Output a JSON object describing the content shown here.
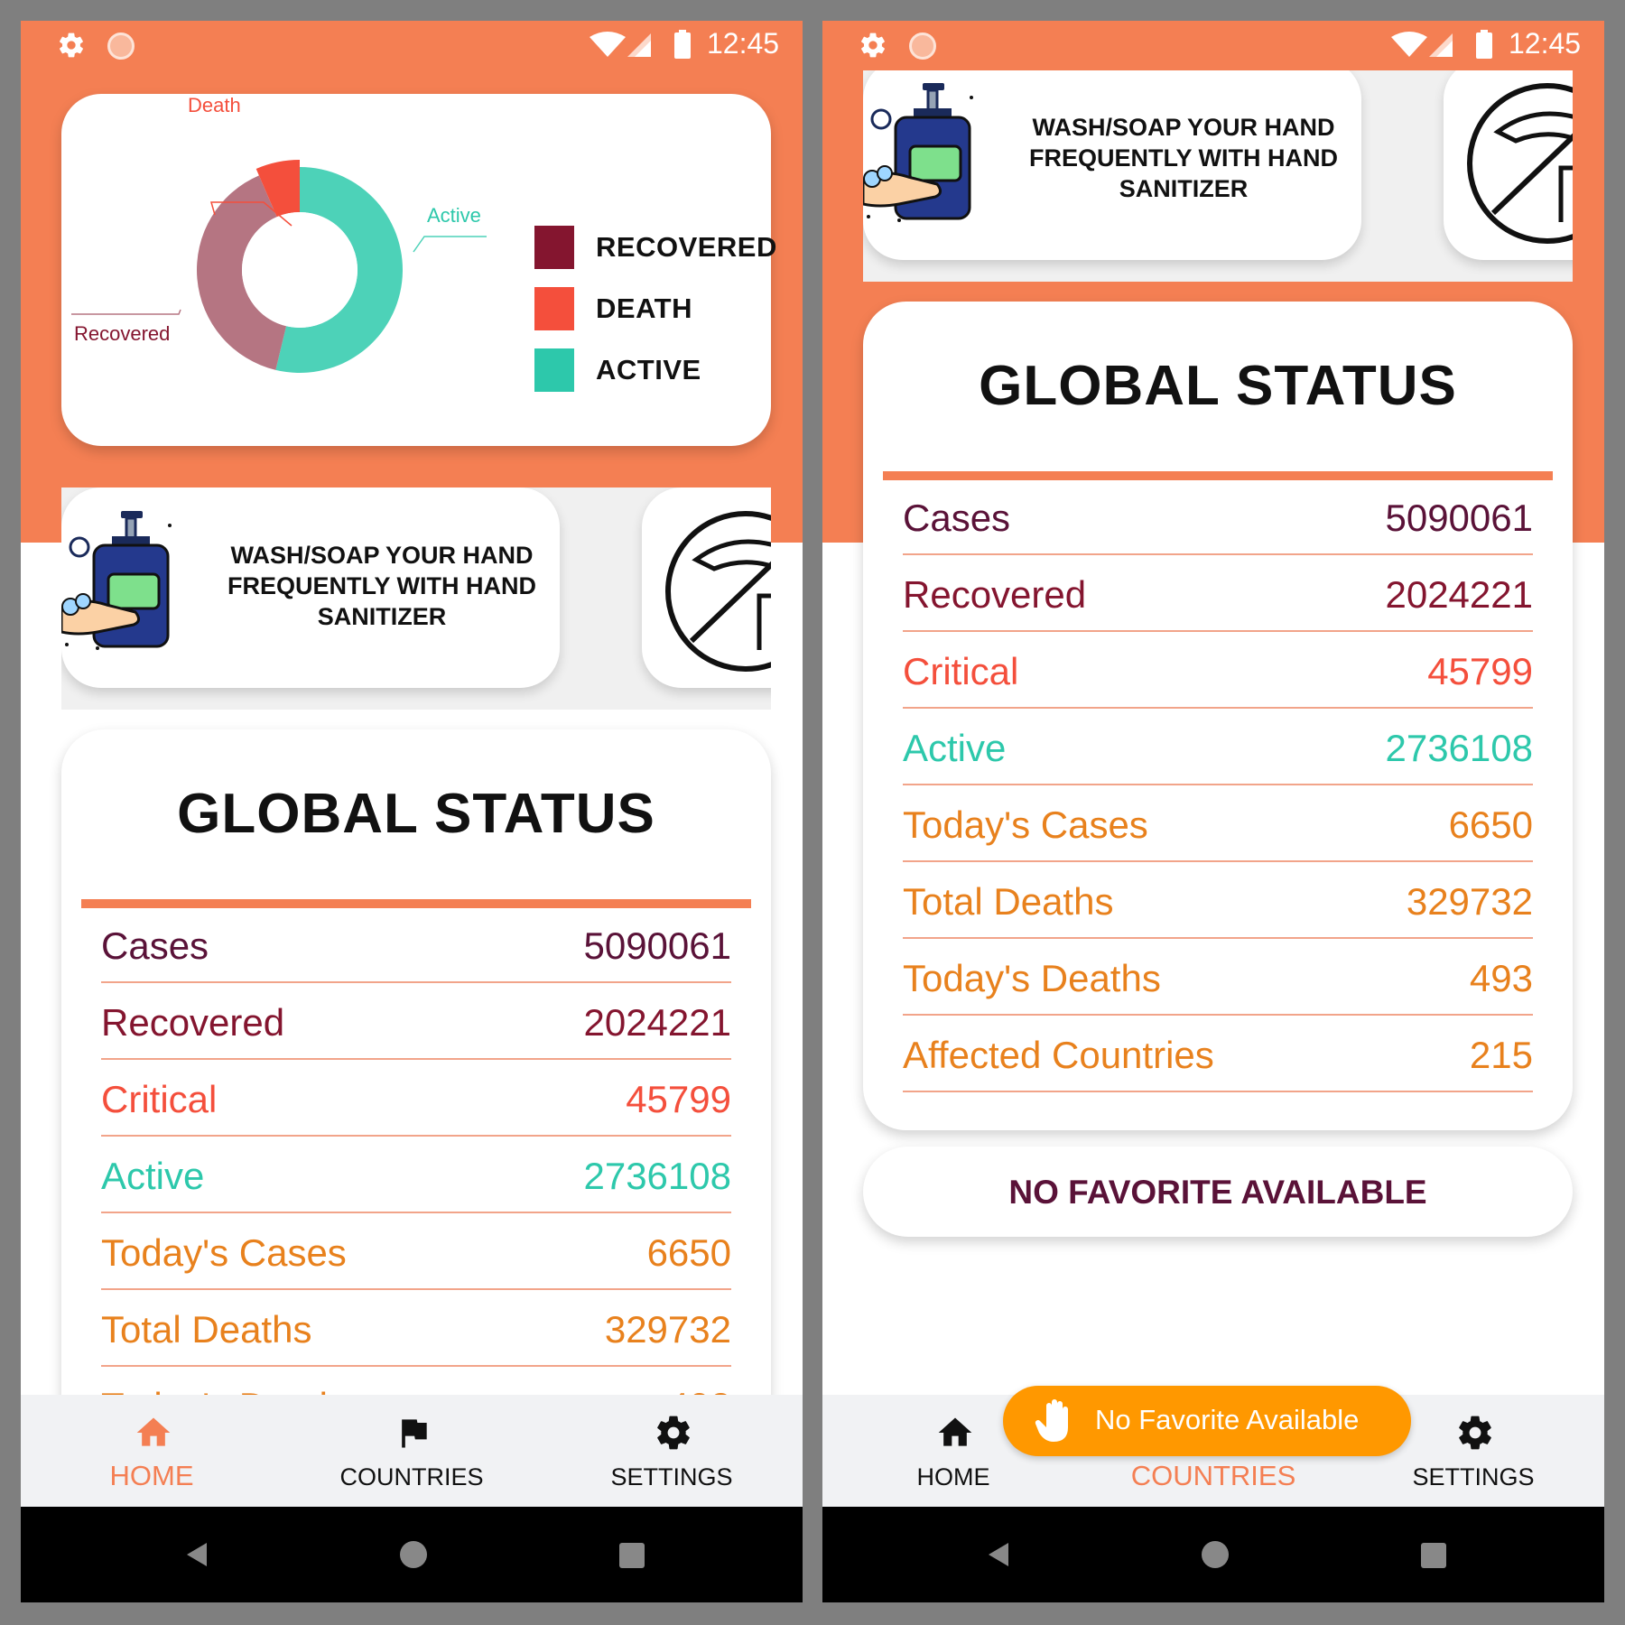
{
  "status_bar": {
    "time": "12:45"
  },
  "chart": {
    "legend": [
      {
        "label": "RECOVERED",
        "color": "#84152f"
      },
      {
        "label": "DEATH",
        "color": "#f44f3c"
      },
      {
        "label": "ACTIVE",
        "color": "#2dc8ab"
      }
    ],
    "callouts": {
      "death": "Death",
      "active": "Active",
      "recovered": "Recovered"
    }
  },
  "chart_data": {
    "type": "pie",
    "series": [
      {
        "name": "Active",
        "value": 2736108,
        "color": "#4dd2b8"
      },
      {
        "name": "Recovered",
        "value": 2024221,
        "color": "#b57582"
      },
      {
        "name": "Death",
        "value": 329732,
        "color": "#f44f3c"
      }
    ]
  },
  "tips": {
    "wash_text": "WASH/SOAP YOUR HAND FREQUENTLY WITH HAND SANITIZER"
  },
  "global_status": {
    "title": "GLOBAL STATUS",
    "rows": [
      {
        "label": "Cases",
        "value": "5090061",
        "color": "#5a1238"
      },
      {
        "label": "Recovered",
        "value": "2024221",
        "color": "#84152f"
      },
      {
        "label": "Critical",
        "value": "45799",
        "color": "#f44f3c"
      },
      {
        "label": "Active",
        "value": "2736108",
        "color": "#2dc8ab"
      },
      {
        "label": "Today's Cases",
        "value": "6650",
        "color": "#e8811d"
      },
      {
        "label": "Total Deaths",
        "value": "329732",
        "color": "#e8811d"
      },
      {
        "label": "Today's Deaths",
        "value": "493",
        "color": "#e8811d"
      },
      {
        "label": "Affected Countries",
        "value": "215",
        "color": "#e8811d"
      }
    ]
  },
  "favorites": {
    "empty_text": "NO FAVORITE AVAILABLE"
  },
  "nav": {
    "home": "HOME",
    "countries": "COUNTRIES",
    "settings": "SETTINGS",
    "active_color": "#f47f53"
  },
  "toast": {
    "text": "No Favorite Available"
  }
}
